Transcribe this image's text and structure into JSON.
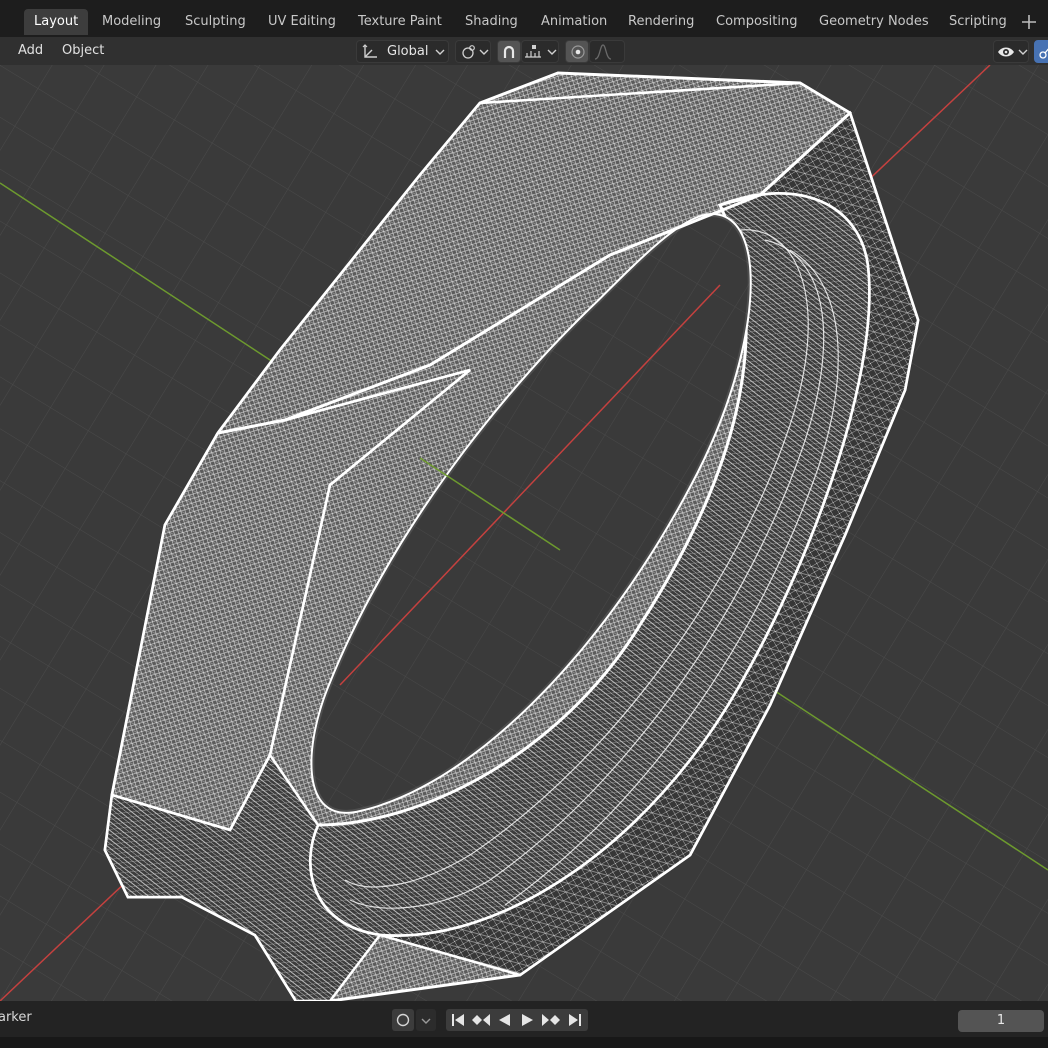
{
  "workspace_tabs": [
    {
      "label": "Layout",
      "active": true
    },
    {
      "label": "Modeling",
      "active": false
    },
    {
      "label": "Sculpting",
      "active": false
    },
    {
      "label": "UV Editing",
      "active": false
    },
    {
      "label": "Texture Paint",
      "active": false
    },
    {
      "label": "Shading",
      "active": false
    },
    {
      "label": "Animation",
      "active": false
    },
    {
      "label": "Rendering",
      "active": false
    },
    {
      "label": "Compositing",
      "active": false
    },
    {
      "label": "Geometry Nodes",
      "active": false
    },
    {
      "label": "Scripting",
      "active": false
    }
  ],
  "add_workspace_icon": "plus-icon",
  "header_menu": {
    "add": "Add",
    "object": "Object"
  },
  "transform_orientation": {
    "icon": "orientation-axes-icon",
    "value": "Global"
  },
  "pivot": {
    "icon": "pivot-point-icon"
  },
  "snap": {
    "icon": "magnet-snap-icon",
    "target_icon": "snap-increment-icon"
  },
  "proportional": {
    "icon": "proportional-edit-icon",
    "falloff_icon": "falloff-curve-icon"
  },
  "visibility": {
    "icon": "eye-icon"
  },
  "timeline": {
    "marker_label": "arker",
    "keying_icon": "record-icon",
    "current_frame": "1",
    "controls": [
      "jump-start-icon",
      "prev-keyframe-icon",
      "play-reverse-icon",
      "play-icon",
      "next-keyframe-icon",
      "jump-end-icon"
    ]
  },
  "colors": {
    "x_axis": "#c4413f",
    "y_axis": "#6d9a2e",
    "grid": "#4a4a4a",
    "viewport_bg": "#3a3a3a",
    "wire": "#ffffff"
  }
}
